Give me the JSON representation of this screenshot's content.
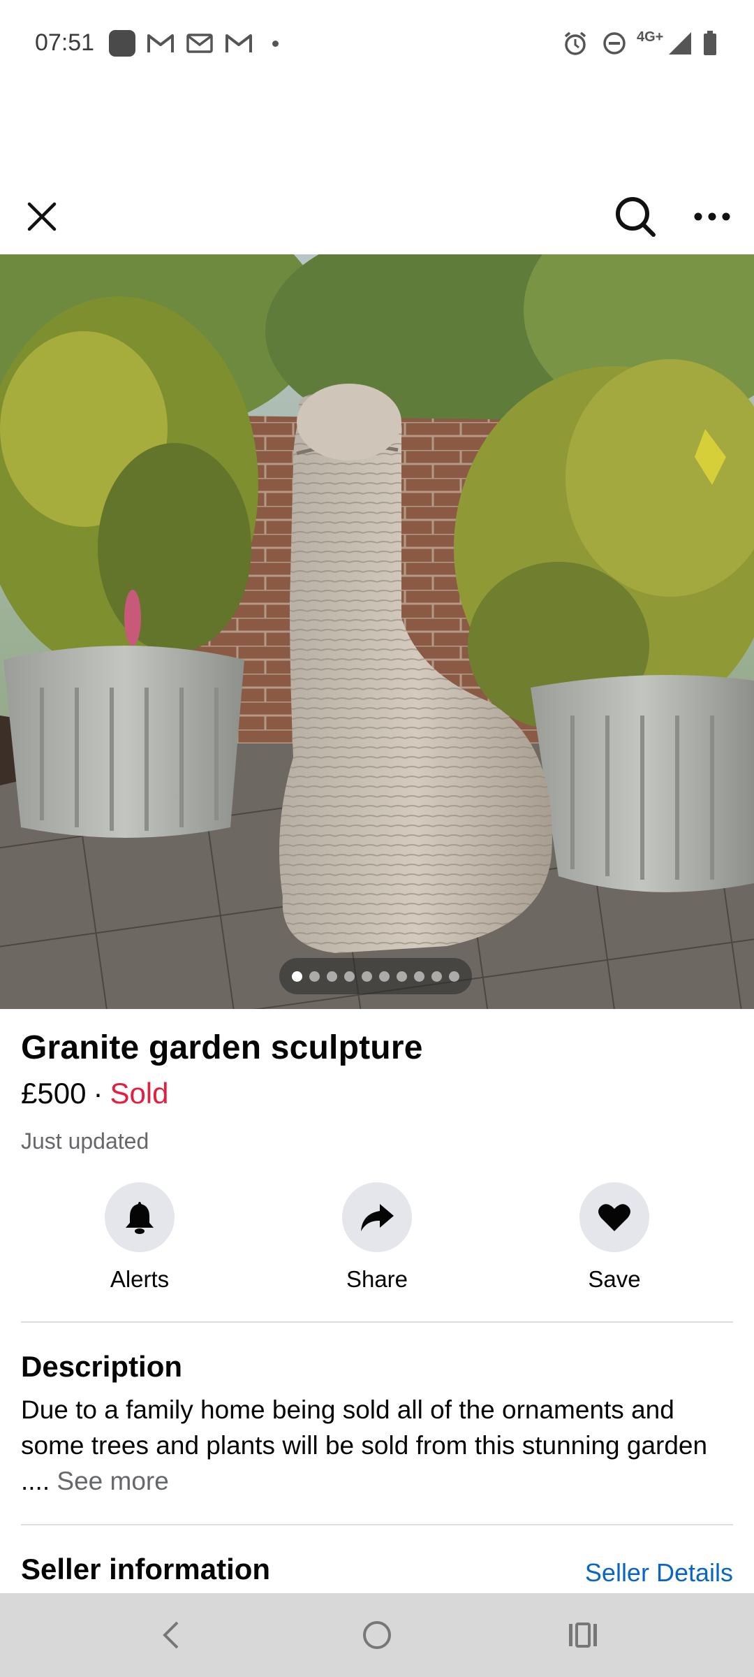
{
  "status_bar": {
    "time": "07:51",
    "network": "4G+",
    "icons": [
      "app-notification-icon",
      "gmail-icon",
      "mail-icon",
      "gmail-icon",
      "dot-icon",
      "alarm-icon",
      "do-not-disturb-icon",
      "signal-icon",
      "battery-icon"
    ]
  },
  "toolbar": {
    "close_icon": "close-icon",
    "search_icon": "search-icon",
    "more_icon": "more-horizontal-icon"
  },
  "gallery": {
    "image_count": 10,
    "active_index": 0
  },
  "listing": {
    "title": "Granite garden sculpture",
    "price": "£500",
    "separator": "·",
    "status": "Sold",
    "updated": "Just updated"
  },
  "actions": [
    {
      "label": "Alerts",
      "icon": "bell-icon"
    },
    {
      "label": "Share",
      "icon": "share-arrow-icon"
    },
    {
      "label": "Save",
      "icon": "heart-icon"
    }
  ],
  "description": {
    "heading": "Description",
    "text": "Due to a family home being sold all of the ornaments and some trees and plants will be sold from this stunning garden ....",
    "see_more": "See more"
  },
  "seller": {
    "heading": "Seller information",
    "link": "Seller Details"
  },
  "nav_bar": {
    "back_icon": "back-icon",
    "home_icon": "home-icon",
    "recents_icon": "recents-icon"
  },
  "colors": {
    "sold": "#e41e3f",
    "link": "#0a66c2",
    "secondary_text": "#65676b",
    "action_circle": "#e4e6eb"
  }
}
